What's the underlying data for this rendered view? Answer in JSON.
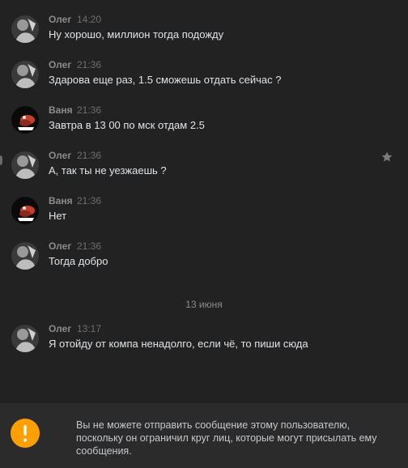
{
  "messages": [
    {
      "author": "Олег",
      "time": "14:20",
      "text": "Ну хорошо, миллион тогда подожду",
      "avatar": "oleg-avatar"
    },
    {
      "author": "Олег",
      "time": "21:36",
      "text": "Здарова еще раз, 1.5 сможешь отдать сейчас ?",
      "avatar": "oleg-avatar"
    },
    {
      "author": "Ваня",
      "time": "21:36",
      "text": "Завтра в 13 00 по мск отдам 2.5",
      "avatar": "vanya-avatar"
    },
    {
      "author": "Олег",
      "time": "21:36",
      "text": "А, так ты не уезжаешь ?",
      "avatar": "oleg-avatar"
    },
    {
      "author": "Ваня",
      "time": "21:36",
      "text": "Нет",
      "avatar": "vanya-avatar"
    },
    {
      "author": "Олег",
      "time": "21:36",
      "text": "Тогда добро",
      "avatar": "oleg-avatar"
    },
    {
      "author": "Олег",
      "time": "13:17",
      "text": "Я отойду от компа ненадолго, если чё, то пиши сюда",
      "avatar": "oleg-avatar"
    }
  ],
  "date_separator": "13 июня",
  "notice": {
    "text": "Вы не можете отправить сообщение этому пользователю, поскольку он ограничил круг лиц, которые могут присылать ему сообщения.",
    "icon": "exclamation-icon",
    "icon_color": "#ffa000"
  },
  "colors": {
    "background": "#222222",
    "author": "#8c8c8c",
    "text": "#e1e3e6"
  }
}
